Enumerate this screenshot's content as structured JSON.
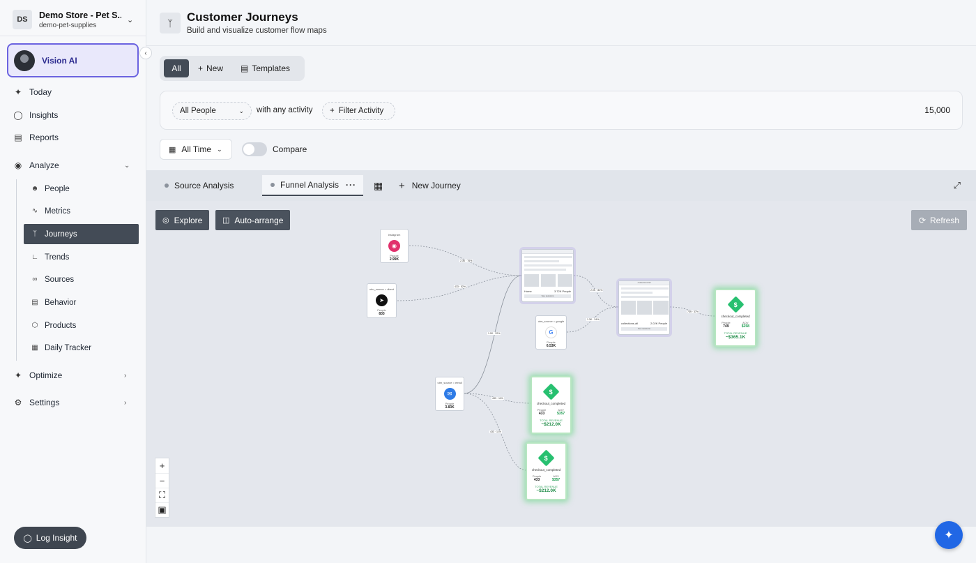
{
  "store": {
    "initials": "DS",
    "name": "Demo Store - Pet S...",
    "slug": "demo-pet-supplies"
  },
  "vision": {
    "label": "Vision AI"
  },
  "nav": {
    "today": "Today",
    "insights": "Insights",
    "reports": "Reports",
    "analyze": "Analyze",
    "optimize": "Optimize",
    "settings": "Settings"
  },
  "subnav": {
    "people": "People",
    "metrics": "Metrics",
    "journeys": "Journeys",
    "trends": "Trends",
    "sources": "Sources",
    "behavior": "Behavior",
    "products": "Products",
    "daily_tracker": "Daily Tracker"
  },
  "log_insight": "Log Insight",
  "header": {
    "title": "Customer Journeys",
    "subtitle": "Build and visualize customer flow maps"
  },
  "segmented": {
    "all": "All",
    "new": "New",
    "templates": "Templates"
  },
  "filter": {
    "people": "All People",
    "with_activity": "with any activity",
    "filter_activity": "Filter Activity",
    "count": "15,000"
  },
  "time": {
    "range": "All Time",
    "compare": "Compare"
  },
  "tabs": {
    "source": "Source Analysis",
    "funnel": "Funnel Analysis",
    "new_journey": "New Journey"
  },
  "canvas": {
    "explore": "Explore",
    "auto_arrange": "Auto-arrange",
    "refresh": "Refresh",
    "nodes": {
      "instagram": {
        "title": "instagram",
        "label": "People",
        "value": "2.99K"
      },
      "direct": {
        "title": "utm_source = direct",
        "label": "People",
        "value": "833"
      },
      "google": {
        "title": "utm_source = google",
        "label": "People",
        "value": "6.53K"
      },
      "email": {
        "title": "utm_source = email",
        "label": "People",
        "value": "3.83K"
      },
      "home": {
        "name": "Home",
        "people": "3.72K People",
        "button": "See sessions"
      },
      "collections": {
        "url": "/collections/all",
        "name": "collections-all",
        "people": "2.02K People",
        "button": "See sessions"
      },
      "goal1": {
        "event": "checkout_completed",
        "people_label": "People",
        "people": "749",
        "aov_label": "AOV",
        "aov": "$258",
        "revenue_label": "TOTAL REVENUE",
        "revenue": "~$365.1K"
      },
      "goal2": {
        "event": "checkout_completed",
        "people_label": "People",
        "people": "433",
        "aov_label": "AOV",
        "aov": "$357",
        "revenue_label": "TOTAL REVENUE",
        "revenue": "~$212.0K"
      },
      "goal3": {
        "event": "checkout_completed",
        "people_label": "People",
        "people": "433",
        "aov_label": "AOV",
        "aov": "$357",
        "revenue_label": "TOTAL REVENUE",
        "revenue": "~$212.0K"
      }
    },
    "edge_labels": {
      "e1": "2.3K · 76%",
      "e2": "433 · 52%",
      "e3": "1.2K · 32%",
      "e4": "2.0K · 84%",
      "e5": "1.3K · 34%",
      "e6": "749 · 37%",
      "e7": "433 · 11%",
      "e8": "433 · 11%"
    }
  },
  "colors": {
    "accent": "#434b56",
    "vision_border": "#6b63e0",
    "goal_green": "#27c070",
    "fab": "#2167e5"
  }
}
